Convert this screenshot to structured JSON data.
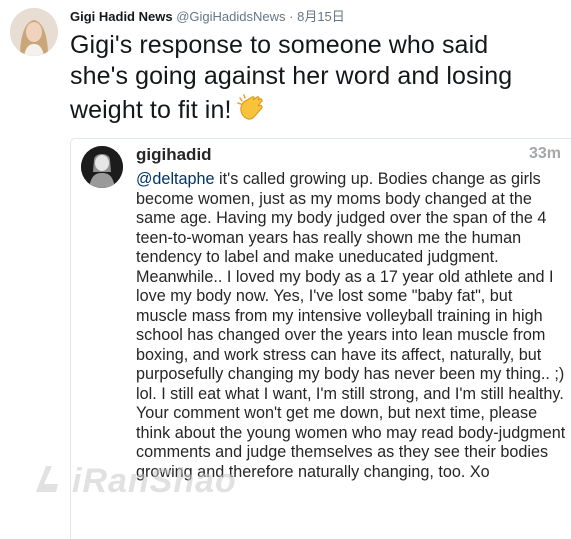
{
  "tweet": {
    "display_name": "Gigi Hadid News",
    "handle": "@GigiHadidsNews",
    "separator": "·",
    "date": "8月15日",
    "text": "Gigi's response to someone who said she's going against her word and losing weight to fit in!",
    "emoji_icon": "clapping-hands-icon"
  },
  "quote": {
    "username": "gigihadid",
    "time": "33m",
    "mention": "@deltaphe",
    "body": " it's called growing up. Bodies change as girls become women, just as my moms body changed at the same age. Having my body judged over the span of the 4 teen-to-woman years has really shown me the human tendency to label and make uneducated judgment. Meanwhile.. I loved my body as a 17 year old athlete and I love my body now. Yes, I've lost some \"baby fat\", but muscle mass from my intensive volleyball training in high school has changed over the years into lean muscle from boxing, and work stress can have its affect, naturally, but purposefully changing my body has never been my thing.. ;) lol. I still eat what I want, I'm still strong, and I'm still healthy. Your comment won't get me down, but next time, please think about the young women who may read body-judgment comments and judge themselves as they see their bodies growing and therefore naturally changing, too. Xo"
  },
  "watermark": {
    "text": "iRanShao"
  },
  "colors": {
    "text": "#14171a",
    "muted": "#657786",
    "mention": "#003569",
    "border": "#e1e8ed"
  }
}
